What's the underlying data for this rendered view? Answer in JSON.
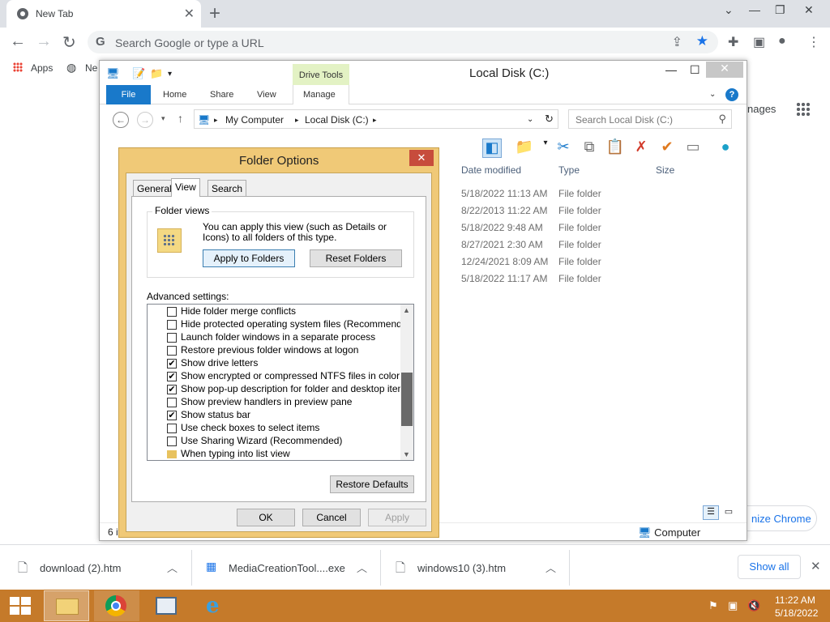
{
  "chrome": {
    "tab_title": "New Tab",
    "omnibox_placeholder": "Search Google or type a URL",
    "bookmarks": [
      "Apps",
      "Ne"
    ],
    "page_right_text": "nages",
    "customize_label": "nize Chrome"
  },
  "explorer": {
    "title": "Local Disk (C:)",
    "drive_tools": "Drive Tools",
    "ribbon_tabs": [
      "File",
      "Home",
      "Share",
      "View",
      "Manage"
    ],
    "breadcrumb": [
      "My Computer",
      "Local Disk (C:)"
    ],
    "search_placeholder": "Search Local Disk (C:)",
    "columns": [
      "Date modified",
      "Type",
      "Size"
    ],
    "rows": [
      {
        "date": "5/18/2022 11:13 AM",
        "type": "File folder"
      },
      {
        "date": "8/22/2013 11:22 AM",
        "type": "File folder"
      },
      {
        "date": "5/18/2022 9:48 AM",
        "type": "File folder"
      },
      {
        "date": "8/27/2021 2:30 AM",
        "type": "File folder"
      },
      {
        "date": "12/24/2021 8:09 AM",
        "type": "File folder"
      },
      {
        "date": "5/18/2022 11:17 AM",
        "type": "File folder"
      }
    ],
    "status_count": "6 it",
    "status_location": "Computer"
  },
  "dialog": {
    "title": "Folder Options",
    "tabs": [
      "General",
      "View",
      "Search"
    ],
    "active_tab": "View",
    "folder_views_legend": "Folder views",
    "folder_views_text": "You can apply this view (such as Details or Icons) to all folders of this type.",
    "apply_to_folders": "Apply to Folders",
    "reset_folders": "Reset Folders",
    "advanced_label": "Advanced settings:",
    "advanced_items": [
      {
        "label": "Hide folder merge conflicts",
        "checked": false
      },
      {
        "label": "Hide protected operating system files (Recommended)",
        "checked": false
      },
      {
        "label": "Launch folder windows in a separate process",
        "checked": false
      },
      {
        "label": "Restore previous folder windows at logon",
        "checked": false
      },
      {
        "label": "Show drive letters",
        "checked": true
      },
      {
        "label": "Show encrypted or compressed NTFS files in color",
        "checked": true
      },
      {
        "label": "Show pop-up description for folder and desktop items",
        "checked": true
      },
      {
        "label": "Show preview handlers in preview pane",
        "checked": false
      },
      {
        "label": "Show status bar",
        "checked": true
      },
      {
        "label": "Use check boxes to select items",
        "checked": false
      },
      {
        "label": "Use Sharing Wizard (Recommended)",
        "checked": false
      },
      {
        "label": "When typing into list view",
        "checked": null
      }
    ],
    "restore_defaults": "Restore Defaults",
    "ok": "OK",
    "cancel": "Cancel",
    "apply": "Apply"
  },
  "downloads": {
    "items": [
      "download (2).htm",
      "MediaCreationTool....exe",
      "windows10 (3).htm"
    ],
    "show_all": "Show all"
  },
  "taskbar": {
    "time": "11:22 AM",
    "date": "5/18/2022"
  },
  "colors": {
    "accent": "#1979ca",
    "dialog_frame": "#f0c977",
    "taskbar": "#c57a2a"
  }
}
